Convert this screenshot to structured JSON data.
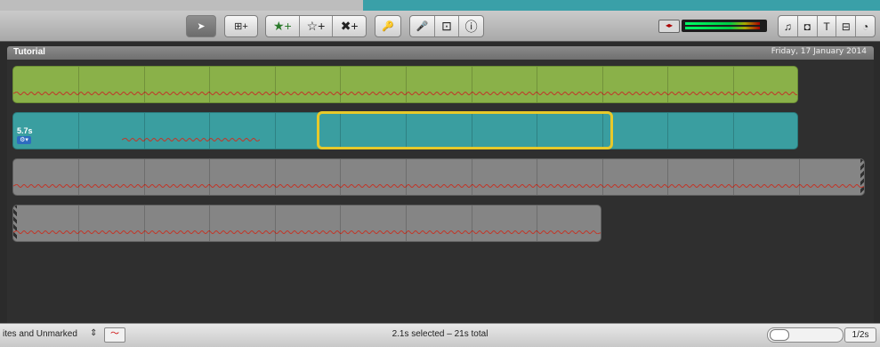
{
  "toolbar": {
    "tools": [
      {
        "name": "arrow-tool",
        "glyph": "➤"
      },
      {
        "name": "add-to-movie",
        "glyph": "⊞+"
      },
      {
        "name": "mark-favorite",
        "glyph": "★+"
      },
      {
        "name": "unmark",
        "glyph": "☆+"
      },
      {
        "name": "reject",
        "glyph": "✖+"
      },
      {
        "name": "keyword",
        "glyph": "🔑"
      },
      {
        "name": "voiceover",
        "glyph": "🎤"
      },
      {
        "name": "crop",
        "glyph": "⊡"
      },
      {
        "name": "inspector",
        "glyph": "ⓘ"
      }
    ],
    "right_buttons": [
      "♫",
      "◘",
      "T",
      "⊟",
      "◔"
    ]
  },
  "event": {
    "title": "Tutorial",
    "date": "Friday, 17 January 2014"
  },
  "clips": [
    {
      "type": "green",
      "duration": ""
    },
    {
      "type": "teal",
      "duration": "5.7s"
    },
    {
      "type": "gray",
      "duration": ""
    },
    {
      "type": "gray",
      "duration": ""
    }
  ],
  "status": {
    "filter": "ites and Unmarked",
    "selection": "2.1s selected – 21s total",
    "zoom": "1/2s"
  }
}
